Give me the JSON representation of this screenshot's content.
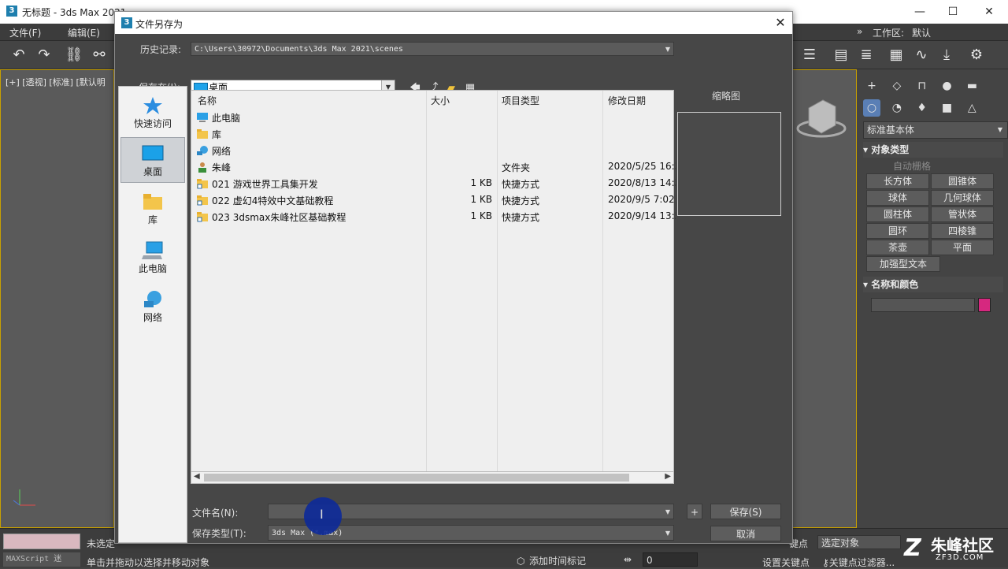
{
  "app": {
    "title": "无标题 - 3ds Max 2021",
    "logo": "3",
    "menus": [
      "文件(F)",
      "编辑(E)"
    ],
    "workspace_label": "工作区:",
    "workspace_value": "默认",
    "viewport_label": "[+] [透视] [标准] [默认明",
    "minimize_glyph": "—",
    "maximize_glyph": "☐",
    "close_glyph": "✕"
  },
  "command_panel": {
    "dropdown": "标准基本体",
    "object_type_header": "▾ 对象类型",
    "auto_grid": "自动栅格",
    "buttons": [
      "长方体",
      "圆锥体",
      "球体",
      "几何球体",
      "圆柱体",
      "管状体",
      "圆环",
      "四棱锥",
      "茶壶",
      "平面",
      "加强型文本"
    ],
    "name_color_header": "▾ 名称和颜色",
    "color_swatch": "#d6287f"
  },
  "bottom": {
    "maxscript": "MAXScript 迷",
    "status1": "未选定",
    "status2": "单击并拖动以选择并移动对象",
    "add_time_tag": "添加时间标记",
    "frame_value": "0",
    "keypoint": "键点",
    "selected_object": "选定对象",
    "set_key": "设置关键点",
    "key_filter": "关键点过滤器..."
  },
  "dialog": {
    "title": "文件另存为",
    "logo": "3",
    "close_glyph": "✕",
    "history_label": "历史记录:",
    "history_value": "C:\\Users\\30972\\Documents\\3ds Max 2021\\scenes",
    "save_in_label": "保存在(I):",
    "save_in_value": "桌面",
    "thumbnail_label": "缩略图",
    "places": [
      "快速访问",
      "桌面",
      "库",
      "此电脑",
      "网络"
    ],
    "columns": {
      "name": "名称",
      "size": "大小",
      "type": "项目类型",
      "date": "修改日期"
    },
    "rows": [
      {
        "name": "此电脑",
        "size": "",
        "type": "",
        "date": "",
        "icon": "computer-icon"
      },
      {
        "name": "库",
        "size": "",
        "type": "",
        "date": "",
        "icon": "library-icon"
      },
      {
        "name": "网络",
        "size": "",
        "type": "",
        "date": "",
        "icon": "network-icon"
      },
      {
        "name": "朱峰",
        "size": "",
        "type": "文件夹",
        "date": "2020/5/25 16:3",
        "icon": "user-folder-icon"
      },
      {
        "name": "021 游戏世界工具集开发",
        "size": "1 KB",
        "type": "快捷方式",
        "date": "2020/8/13 14:3",
        "icon": "shortcut-folder-icon"
      },
      {
        "name": "022 虚幻4特效中文基础教程",
        "size": "1 KB",
        "type": "快捷方式",
        "date": "2020/9/5 7:02",
        "icon": "shortcut-folder-icon"
      },
      {
        "name": "023 3dsmax朱峰社区基础教程",
        "size": "1 KB",
        "type": "快捷方式",
        "date": "2020/9/14 13:5",
        "icon": "shortcut-folder-icon"
      }
    ],
    "filename_label": "文件名(N):",
    "filename_value": "",
    "filetype_label": "保存类型(T):",
    "filetype_value": "3ds Max (*.max)",
    "plus_label": "+",
    "save_button": "保存(S)",
    "cancel_button": "取消"
  },
  "watermark": {
    "big": "朱峰社区",
    "small": "ZF3D.COM",
    "logo": "Z"
  }
}
